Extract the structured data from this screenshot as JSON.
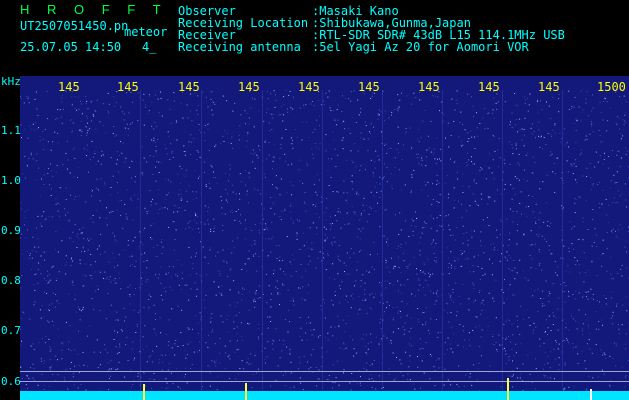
{
  "header": {
    "title": "H R O F F T",
    "filename": "UT2507051450.pn",
    "mode": "meteor",
    "timestamp": "25.07.05 14:50",
    "count": "4_"
  },
  "meta": {
    "observer_label": "Observer",
    "observer_value": ":Masaki Kano",
    "location_label": "Receiving Location",
    "location_value": ":Shibukawa,Gunma,Japan",
    "receiver_label": "Receiver",
    "receiver_value": ":RTL-SDR SDR# 43dB L15 114.1MHz USB",
    "antenna_label": "Receiving antenna",
    "antenna_value": ":5el Yagi Az 20 for Aomori VOR"
  },
  "axes": {
    "y_unit": "kHz",
    "y_ticks": [
      "1.1",
      "1.0",
      "0.9",
      "0.8",
      "0.7",
      "0.6"
    ],
    "x_ticks": [
      "145",
      "145",
      "145",
      "145",
      "145",
      "145",
      "145",
      "145",
      "145",
      "1500"
    ]
  },
  "colors": {
    "background": "#000000",
    "plot": "#12197a",
    "text": "#00ffff",
    "title": "#00ff40",
    "ticks": "#ffff00",
    "floor": "#00e5ff"
  }
}
